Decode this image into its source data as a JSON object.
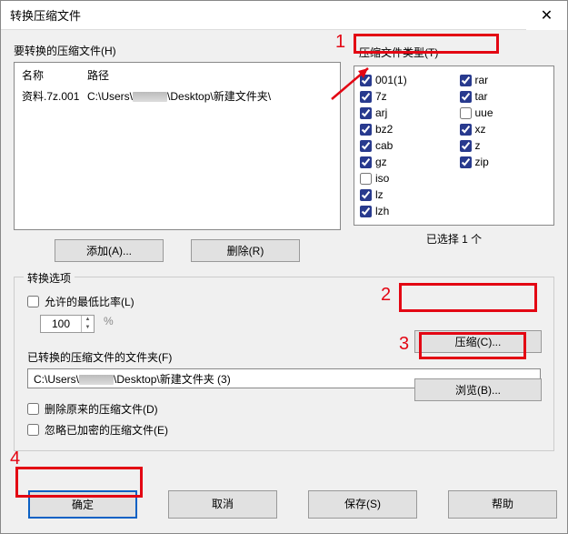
{
  "title": "转换压缩文件",
  "close_glyph": "✕",
  "labels": {
    "files_to_convert": "要转换的压缩文件(H)",
    "archive_types": "压缩文件类型(T)",
    "selected_count": "已选择 1 个",
    "convert_options": "转换选项",
    "allow_min_ratio": "允许的最低比率(L)",
    "percent": "%",
    "folder_label": "已转换的压缩文件的文件夹(F)",
    "delete_original": "删除原来的压缩文件(D)",
    "ignore_encrypted": "忽略已加密的压缩文件(E)"
  },
  "table": {
    "headers": {
      "name": "名称",
      "path": "路径"
    },
    "rows": [
      {
        "name": "资料.7z.001",
        "path_pre": "C:\\Users\\",
        "path_post": "\\Desktop\\新建文件夹\\"
      }
    ]
  },
  "types": [
    {
      "label": "001(1)",
      "checked": true
    },
    {
      "label": "7z",
      "checked": true
    },
    {
      "label": "arj",
      "checked": true
    },
    {
      "label": "bz2",
      "checked": true
    },
    {
      "label": "cab",
      "checked": true
    },
    {
      "label": "gz",
      "checked": true
    },
    {
      "label": "iso",
      "checked": false
    },
    {
      "label": "lz",
      "checked": true
    },
    {
      "label": "lzh",
      "checked": true
    },
    {
      "label": "rar",
      "checked": true
    },
    {
      "label": "tar",
      "checked": true
    },
    {
      "label": "uue",
      "checked": false
    },
    {
      "label": "xz",
      "checked": true
    },
    {
      "label": "z",
      "checked": true
    },
    {
      "label": "zip",
      "checked": true
    }
  ],
  "buttons": {
    "add": "添加(A)...",
    "delete": "删除(R)",
    "compress": "压缩(C)...",
    "browse": "浏览(B)...",
    "ok": "确定",
    "cancel": "取消",
    "save": "保存(S)",
    "help": "帮助"
  },
  "spinner_value": "100",
  "folder_value_pre": "C:\\Users\\",
  "folder_value_post": "\\Desktop\\新建文件夹 (3)",
  "annotations": {
    "n1": "1",
    "n2": "2",
    "n3": "3",
    "n4": "4"
  }
}
